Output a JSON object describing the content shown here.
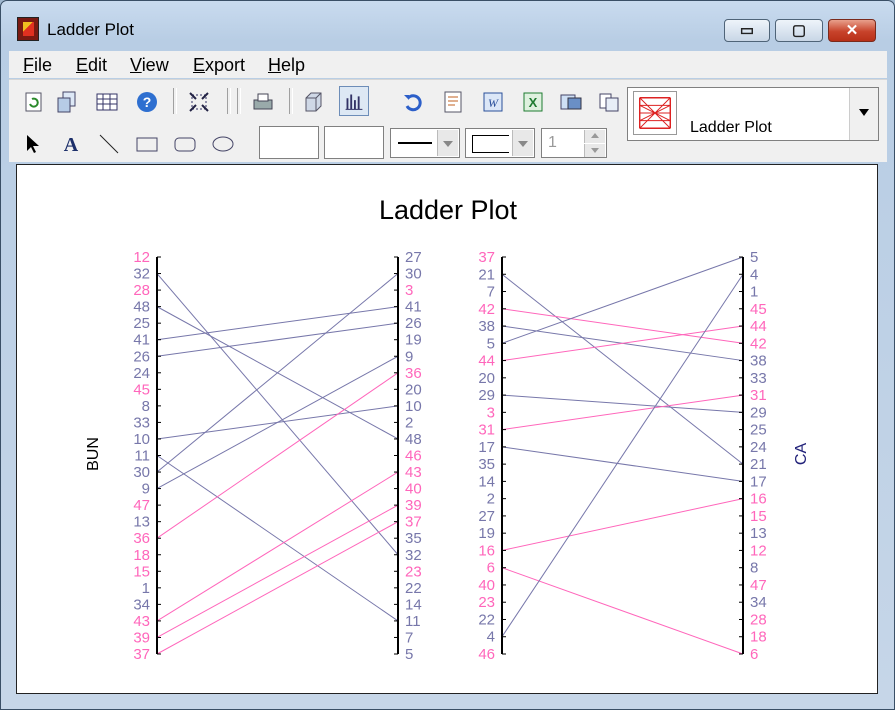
{
  "window": {
    "title": "Ladder Plot",
    "caption_buttons": {
      "minimize": "▭",
      "maximize": "▢",
      "close": "✕"
    }
  },
  "menu": {
    "items": [
      "File",
      "Edit",
      "View",
      "Export",
      "Help"
    ],
    "accelerators": [
      "F",
      "E",
      "V",
      "E",
      "H"
    ]
  },
  "toolbar": {
    "top_icons": [
      "refresh-icon",
      "copy-chart-icon",
      "table-icon",
      "help-icon",
      "fit-icon",
      "print-icon",
      "3d-icon",
      "bar-chart-icon",
      "undo-icon",
      "notes-icon",
      "word-export-icon",
      "excel-export-icon",
      "image-export-icon",
      "copy-icon"
    ],
    "draw_tools": [
      "pointer-icon",
      "text-tool-icon",
      "line-tool-icon",
      "rectangle-tool-icon",
      "rounded-rectangle-tool-icon",
      "ellipse-tool-icon"
    ],
    "line_width_value": "1",
    "chart_type_selected": "Ladder Plot"
  },
  "colors": {
    "pink": "#ff66bb",
    "slate": "#7777aa",
    "axis": "#000000"
  },
  "chart_data": {
    "type": "ladder",
    "title": "Ladder Plot",
    "left_ladder": {
      "axis_label": "BUN",
      "left_ticks": [
        "12",
        "32",
        "28",
        "48",
        "25",
        "41",
        "26",
        "24",
        "45",
        "8",
        "33",
        "10",
        "11",
        "30",
        "9",
        "47",
        "13",
        "36",
        "18",
        "15",
        "1",
        "34",
        "43",
        "39",
        "37"
      ],
      "left_colors": [
        "pink",
        "slate",
        "pink",
        "slate",
        "slate",
        "slate",
        "slate",
        "slate",
        "pink",
        "slate",
        "slate",
        "slate",
        "slate",
        "slate",
        "slate",
        "pink",
        "slate",
        "pink",
        "pink",
        "pink",
        "slate",
        "slate",
        "pink",
        "pink",
        "pink"
      ],
      "right_ticks": [
        "27",
        "30",
        "3",
        "41",
        "26",
        "19",
        "9",
        "36",
        "20",
        "10",
        "2",
        "48",
        "46",
        "43",
        "40",
        "39",
        "37",
        "35",
        "32",
        "23",
        "22",
        "14",
        "11",
        "7",
        "5"
      ],
      "right_colors": [
        "slate",
        "slate",
        "pink",
        "slate",
        "slate",
        "slate",
        "slate",
        "pink",
        "slate",
        "slate",
        "slate",
        "slate",
        "pink",
        "pink",
        "pink",
        "pink",
        "pink",
        "slate",
        "slate",
        "pink",
        "slate",
        "slate",
        "slate",
        "slate",
        "slate"
      ]
    },
    "right_ladder": {
      "axis_label": "CA",
      "left_ticks": [
        "37",
        "21",
        "7",
        "42",
        "38",
        "5",
        "44",
        "20",
        "29",
        "3",
        "31",
        "17",
        "35",
        "14",
        "2",
        "27",
        "19",
        "16",
        "6",
        "40",
        "23",
        "22",
        "4",
        "46"
      ],
      "left_colors": [
        "pink",
        "slate",
        "slate",
        "pink",
        "slate",
        "slate",
        "pink",
        "slate",
        "slate",
        "pink",
        "pink",
        "slate",
        "slate",
        "slate",
        "slate",
        "slate",
        "slate",
        "pink",
        "pink",
        "pink",
        "pink",
        "slate",
        "slate",
        "pink"
      ],
      "right_ticks": [
        "5",
        "4",
        "1",
        "45",
        "44",
        "42",
        "38",
        "33",
        "31",
        "29",
        "25",
        "24",
        "21",
        "17",
        "16",
        "15",
        "13",
        "12",
        "8",
        "47",
        "34",
        "28",
        "18",
        "6"
      ],
      "right_colors": [
        "slate",
        "slate",
        "slate",
        "pink",
        "pink",
        "pink",
        "slate",
        "slate",
        "pink",
        "slate",
        "slate",
        "slate",
        "slate",
        "slate",
        "pink",
        "pink",
        "slate",
        "pink",
        "slate",
        "pink",
        "slate",
        "pink",
        "pink",
        "pink"
      ]
    }
  }
}
